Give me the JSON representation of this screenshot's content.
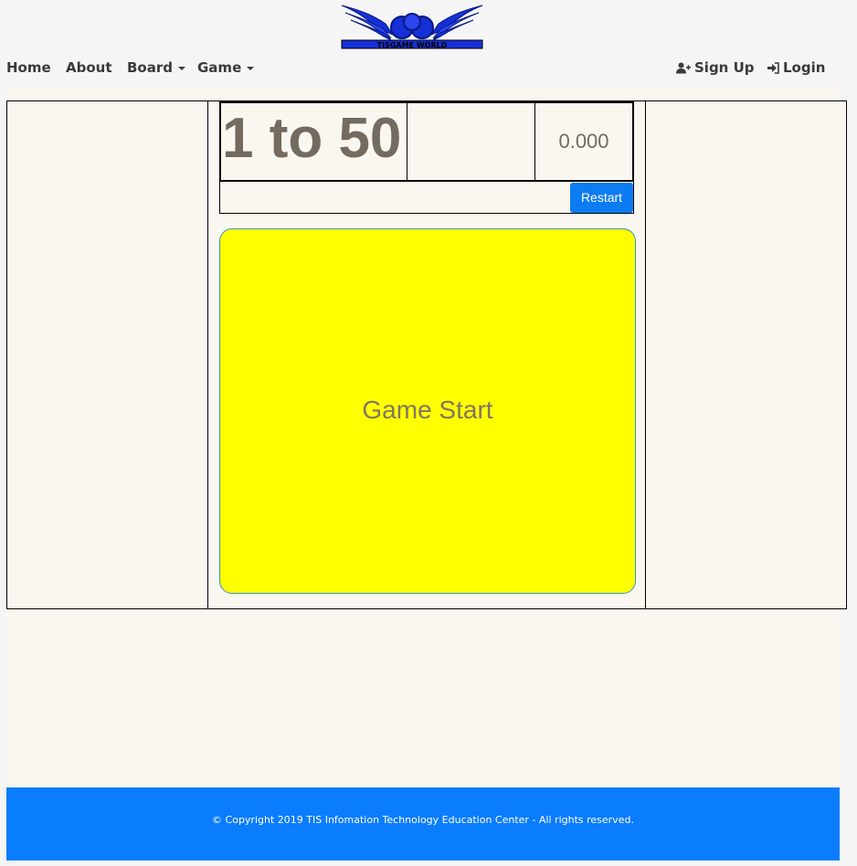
{
  "header": {
    "logo_text": "TISGAME WORLD",
    "nav_left": [
      {
        "label": "Home"
      },
      {
        "label": "About"
      },
      {
        "label": "Board"
      },
      {
        "label": "Game"
      }
    ],
    "nav_right": [
      {
        "label": "Sign Up",
        "icon": "user-plus-icon"
      },
      {
        "label": "Login",
        "icon": "sign-in-icon"
      }
    ]
  },
  "game": {
    "title": "1 to 50",
    "timer": "0.000",
    "restart_label": "Restart",
    "start_label": "Game Start"
  },
  "footer": {
    "copyright": "© Copyright 2019 TIS Infomation Technology Education Center - All rights reserved."
  },
  "colors": {
    "board": "#ffff00",
    "button": "#0d7cf2",
    "footer": "#0a7cfe",
    "logo": "#1630d8"
  }
}
